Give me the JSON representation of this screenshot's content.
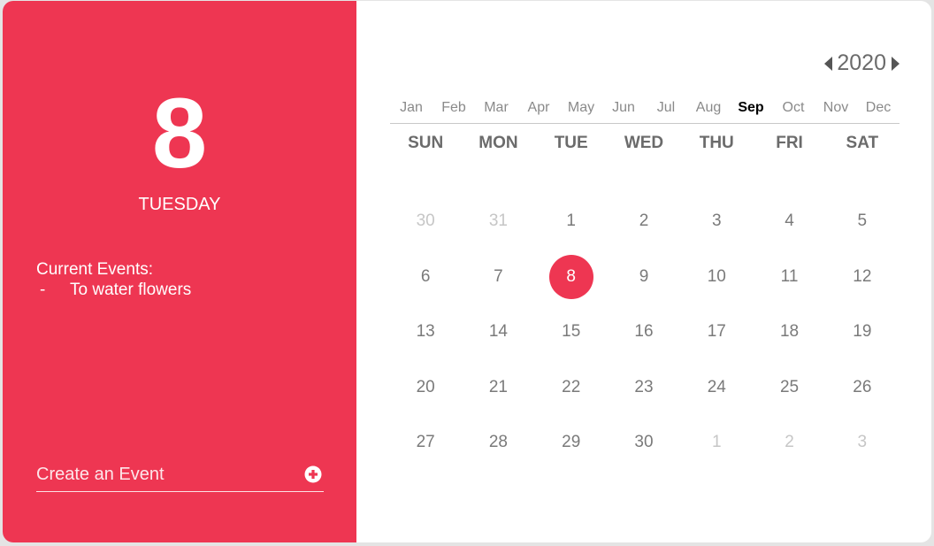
{
  "selected": {
    "day_number": "8",
    "weekday": "TUESDAY"
  },
  "events": {
    "heading": "Current Events:",
    "items": [
      {
        "dash": "-",
        "text": "To water flowers"
      }
    ]
  },
  "create_event": {
    "placeholder": "Create an Event",
    "icon": "plus-circle-icon"
  },
  "year_nav": {
    "year": "2020",
    "prev_icon": "caret-left-icon",
    "next_icon": "caret-right-icon"
  },
  "months": [
    "Jan",
    "Feb",
    "Mar",
    "Apr",
    "May",
    "Jun",
    "Jul",
    "Aug",
    "Sep",
    "Oct",
    "Nov",
    "Dec"
  ],
  "active_month": "Sep",
  "weekdays": [
    "SUN",
    "MON",
    "TUE",
    "WED",
    "THU",
    "FRI",
    "SAT"
  ],
  "weeks": [
    [
      {
        "d": "30",
        "muted": true
      },
      {
        "d": "31",
        "muted": true
      },
      {
        "d": "1"
      },
      {
        "d": "2"
      },
      {
        "d": "3"
      },
      {
        "d": "4"
      },
      {
        "d": "5"
      }
    ],
    [
      {
        "d": "6"
      },
      {
        "d": "7"
      },
      {
        "d": "8",
        "selected": true
      },
      {
        "d": "9"
      },
      {
        "d": "10"
      },
      {
        "d": "11"
      },
      {
        "d": "12"
      }
    ],
    [
      {
        "d": "13"
      },
      {
        "d": "14"
      },
      {
        "d": "15"
      },
      {
        "d": "16"
      },
      {
        "d": "17"
      },
      {
        "d": "18"
      },
      {
        "d": "19"
      }
    ],
    [
      {
        "d": "20"
      },
      {
        "d": "21"
      },
      {
        "d": "22"
      },
      {
        "d": "23"
      },
      {
        "d": "24"
      },
      {
        "d": "25"
      },
      {
        "d": "26"
      }
    ],
    [
      {
        "d": "27"
      },
      {
        "d": "28"
      },
      {
        "d": "29"
      },
      {
        "d": "30"
      },
      {
        "d": "1",
        "muted": true
      },
      {
        "d": "2",
        "muted": true
      },
      {
        "d": "3",
        "muted": true
      }
    ]
  ],
  "colors": {
    "accent": "#ee3652",
    "text_gray": "#7a7a7a",
    "muted_gray": "#c6c6c6"
  }
}
